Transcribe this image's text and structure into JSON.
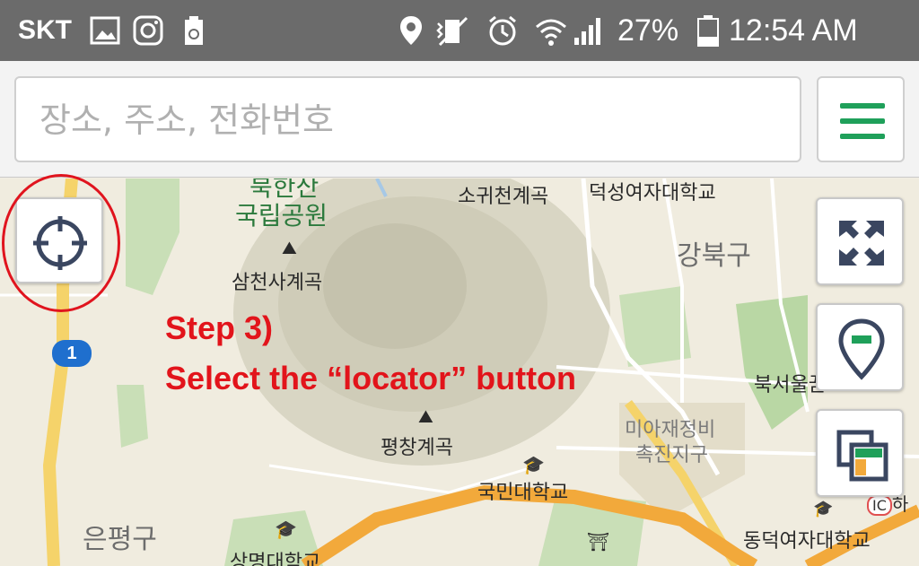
{
  "status_bar": {
    "carrier": "SKT",
    "battery_percent": "27%",
    "time": "12:54 AM",
    "icons": [
      "image-icon",
      "instagram-icon",
      "recycle-icon",
      "location-icon",
      "vibrate-icon",
      "alarm-icon",
      "wifi-icon",
      "signal-icon",
      "battery-icon"
    ]
  },
  "search": {
    "placeholder": "장소, 주소, 전화번호"
  },
  "map": {
    "labels": {
      "bukhansan": "북한산",
      "national_park": "국립공원",
      "samcheonsa": "삼천사계곡",
      "sogwicheon": "소귀천계곡",
      "duksung": "덕성여자대학교",
      "gangbuk": "강북구",
      "bukseoul": "북서울꿈",
      "miajae_1": "미아재정비",
      "miajae_2": "촉진지구",
      "pyeongchang": "평창계곡",
      "kookmin": "국민대학교",
      "eunpyeong": "은평구",
      "dongduk": "동덕여자대학교",
      "sangmyung": "상명대학교",
      "ic": "IC",
      "ic_suffix": "하",
      "route_number": "1"
    }
  },
  "annotation": {
    "line1": "Step 3)",
    "line2": "Select the “locator” button"
  },
  "colors": {
    "accent_green": "#1fa05a",
    "annotation_red": "#e2141b",
    "icon_navy": "#3a4660",
    "road_orange": "#f2a93b"
  }
}
